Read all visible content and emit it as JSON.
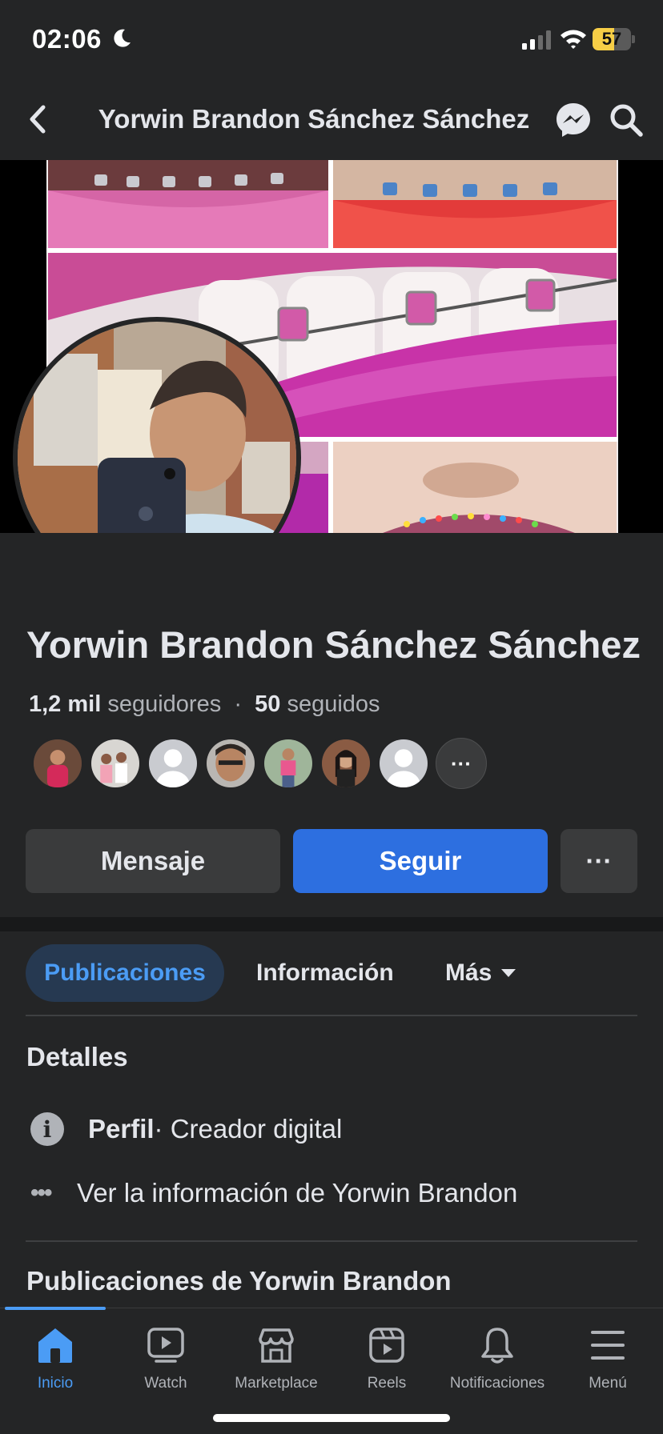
{
  "status_bar": {
    "time": "02:06",
    "battery": "57",
    "battery_level": 0.57
  },
  "header": {
    "title": "Yorwin Brandon Sánchez Sánchez",
    "back_icon": "chevron-left-icon",
    "messenger_icon": "messenger-icon",
    "search_icon": "search-icon"
  },
  "profile": {
    "name": "Yorwin Brandon Sánchez Sánchez",
    "followers_count": "1,2 mil",
    "followers_label": "seguidores",
    "separator": "·",
    "following_count": "50",
    "following_label": "seguidos",
    "more_friends": "···"
  },
  "actions": {
    "message": "Mensaje",
    "follow": "Seguir",
    "more": "···"
  },
  "tabs": {
    "posts": "Publicaciones",
    "info": "Información",
    "more": "Más"
  },
  "details": {
    "title": "Detalles",
    "profile_label": "Perfil",
    "profile_value": " · Creador digital",
    "see_info": "Ver la información de Yorwin Brandon"
  },
  "posts_section": {
    "title": "Publicaciones de Yorwin Brandon"
  },
  "bottom_nav": [
    {
      "label": "Inicio",
      "icon": "home-icon",
      "active": true
    },
    {
      "label": "Watch",
      "icon": "watch-icon",
      "active": false
    },
    {
      "label": "Marketplace",
      "icon": "marketplace-icon",
      "active": false
    },
    {
      "label": "Reels",
      "icon": "reels-icon",
      "active": false
    },
    {
      "label": "Notificaciones",
      "icon": "bell-icon",
      "active": false
    },
    {
      "label": "Menú",
      "icon": "menu-icon",
      "active": false
    }
  ],
  "colors": {
    "background": "#242526",
    "accent": "#2d6fe0",
    "active_tab_text": "#4b9cf5",
    "active_tab_bg": "#263951"
  }
}
